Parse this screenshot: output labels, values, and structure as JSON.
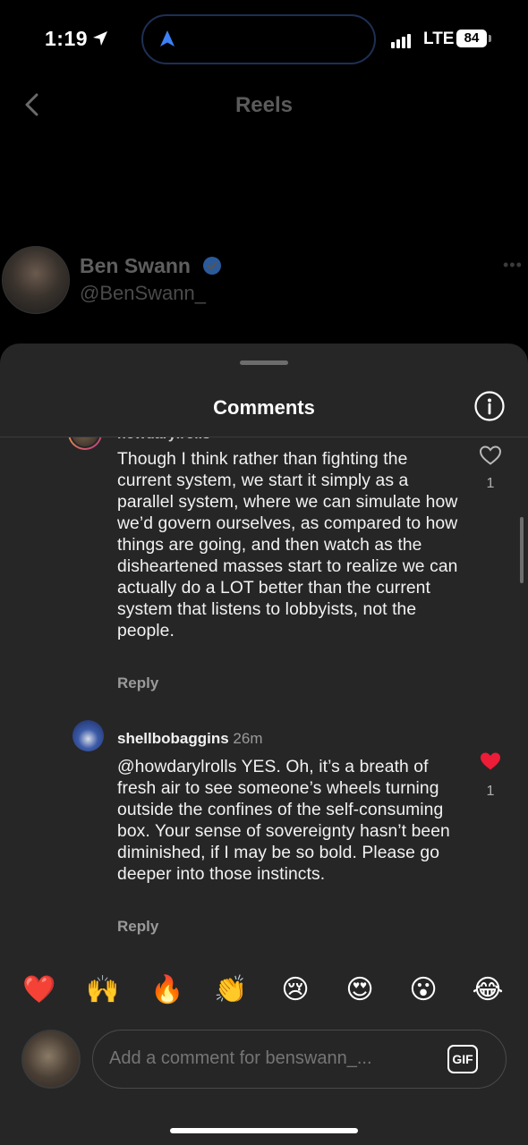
{
  "status_bar": {
    "time": "1:19",
    "network": "LTE",
    "battery": "84"
  },
  "header": {
    "title": "Reels"
  },
  "profile": {
    "name": "Ben Swann",
    "handle": "@BenSwann_",
    "verified": true
  },
  "comments_sheet": {
    "title": "Comments",
    "comments": [
      {
        "username": "howdarylrolls",
        "text": "Though I think rather than fighting the current system, we start it simply as a parallel system, where we can simulate how we’d govern ourselves, as compared to how things are going, and then watch as the disheartened masses start to realize we can actually do a LOT better than the current system that listens to lobbyists, not the people.",
        "reply_label": "Reply",
        "likes": "1",
        "liked": false
      },
      {
        "username": "shellbobaggins",
        "time": "26m",
        "text": "@howdarylrolls YES. Oh, it’s a breath of fresh air to see someone’s wheels turning outside the confines of the self-consuming box. Your sense of sovereignty hasn’t been diminished, if I may be so bold. Please go deeper into those instincts.",
        "reply_label": "Reply",
        "likes": "1",
        "liked": true
      }
    ]
  },
  "quick_reactions": [
    "❤️",
    "🙌",
    "🔥",
    "👏",
    "😢",
    "😍",
    "😮",
    "😂"
  ],
  "composer": {
    "placeholder": "Add a comment for benswann_...",
    "gif_label": "GIF"
  },
  "colors": {
    "sheet_bg": "#262626",
    "like_red": "#ed1c37",
    "verified_blue": "#3897f0"
  }
}
